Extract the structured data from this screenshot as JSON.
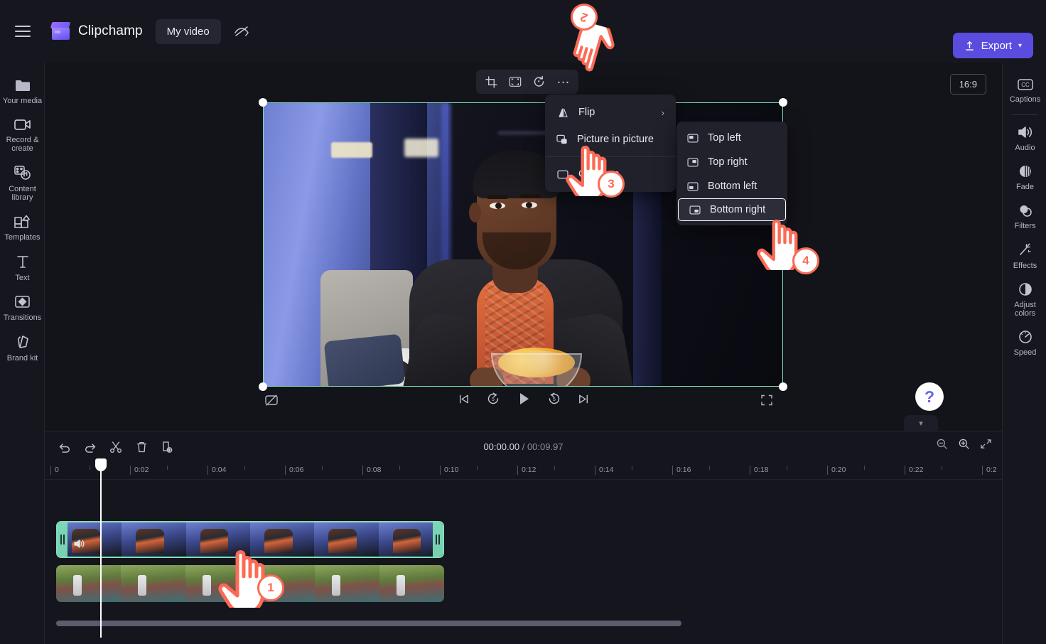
{
  "app": {
    "brand": "Clipchamp",
    "project_name": "My video",
    "export_label": "Export"
  },
  "topbar": {
    "menu_icon": "hamburger-icon",
    "logo_icon": "clipchamp-logo-icon",
    "eye_off_icon": "eye-off-icon",
    "export_icon": "upload-icon",
    "export_chevron": "chevron-down-icon"
  },
  "left_rail": {
    "items": [
      {
        "label": "Your media",
        "icon": "folder-icon"
      },
      {
        "label": "Record & create",
        "icon": "video-camera-icon"
      },
      {
        "label": "Content library",
        "icon": "content-library-icon"
      },
      {
        "label": "Templates",
        "icon": "templates-icon"
      },
      {
        "label": "Text",
        "icon": "text-icon"
      },
      {
        "label": "Transitions",
        "icon": "transitions-icon"
      },
      {
        "label": "Brand kit",
        "icon": "brand-kit-icon"
      }
    ],
    "collapse_icon": "chevron-right-icon"
  },
  "right_rail": {
    "items": [
      {
        "label": "Captions",
        "icon": "cc-icon"
      },
      {
        "label": "Audio",
        "icon": "speaker-icon"
      },
      {
        "label": "Fade",
        "icon": "fade-icon"
      },
      {
        "label": "Filters",
        "icon": "filters-icon"
      },
      {
        "label": "Effects",
        "icon": "magic-wand-icon"
      },
      {
        "label": "Adjust colors",
        "icon": "contrast-icon"
      },
      {
        "label": "Speed",
        "icon": "speedometer-icon"
      }
    ],
    "collapse_icon": "chevron-left-icon"
  },
  "stage": {
    "aspect_ratio": "16:9",
    "float_toolbar": [
      {
        "icon": "crop-icon",
        "name": "crop-button"
      },
      {
        "icon": "fit-icon",
        "name": "fit-button"
      },
      {
        "icon": "rotate-icon",
        "name": "rotate-button"
      },
      {
        "icon": "more-icon",
        "name": "more-options-button",
        "glyph": "…"
      }
    ],
    "selection_color": "#7fe0b8"
  },
  "context_menu": {
    "items": [
      {
        "label": "Flip",
        "icon": "flip-icon",
        "has_submenu": true
      },
      {
        "label": "Picture in picture",
        "icon": "picture-in-picture-icon",
        "has_submenu": true
      },
      {
        "label": "Captions",
        "icon": "captions-icon",
        "has_submenu": false
      }
    ],
    "arrow_glyph": "›"
  },
  "submenu": {
    "items": [
      {
        "label": "Top left",
        "icon": "pip-top-left-icon",
        "selected": false
      },
      {
        "label": "Top right",
        "icon": "pip-top-right-icon",
        "selected": false
      },
      {
        "label": "Bottom left",
        "icon": "pip-bottom-left-icon",
        "selected": false
      },
      {
        "label": "Bottom right",
        "icon": "pip-bottom-right-icon",
        "selected": true
      }
    ]
  },
  "player": {
    "captions_toggle_icon": "captions-off-icon",
    "controls": [
      {
        "icon": "skip-start-icon",
        "name": "skip-to-start-button"
      },
      {
        "icon": "rewind-5-icon",
        "name": "rewind-5s-button",
        "label": "5"
      },
      {
        "icon": "play-icon",
        "name": "play-button"
      },
      {
        "icon": "forward-5-icon",
        "name": "forward-5s-button",
        "label": "5"
      },
      {
        "icon": "skip-end-icon",
        "name": "skip-to-end-button"
      }
    ],
    "fullscreen_icon": "fullscreen-icon",
    "help_glyph": "?",
    "collapse_icon": "chevron-down-icon"
  },
  "timeline": {
    "tools": [
      {
        "icon": "undo-icon",
        "name": "undo-button"
      },
      {
        "icon": "redo-icon",
        "name": "redo-button"
      },
      {
        "icon": "scissors-icon",
        "name": "split-button"
      },
      {
        "icon": "trash-icon",
        "name": "delete-button"
      },
      {
        "icon": "duplicate-icon",
        "name": "duplicate-button"
      }
    ],
    "current_time": "00:00.00",
    "total_time": "00:09.97",
    "time_separator": "/",
    "zoom_out_icon": "zoom-out-icon",
    "zoom_in_icon": "zoom-in-icon",
    "fit_icon": "fit-timeline-icon",
    "ruler_labels": [
      "0",
      "0:02",
      "0:04",
      "0:06",
      "0:08",
      "0:10",
      "0:12",
      "0:14",
      "0:16",
      "0:18",
      "0:20",
      "0:22",
      "0:2"
    ],
    "tracks": [
      {
        "name": "video-clip-top",
        "selected": true,
        "has_audio_icon": true
      },
      {
        "name": "video-clip-bottom",
        "selected": false,
        "has_audio_icon": false
      }
    ]
  },
  "annotations": [
    {
      "number": "1",
      "name": "step-1-badge"
    },
    {
      "number": "2",
      "name": "step-2-badge"
    },
    {
      "number": "3",
      "name": "step-3-badge"
    },
    {
      "number": "4",
      "name": "step-4-badge"
    }
  ],
  "colors": {
    "accent": "#5b4ce0",
    "selection": "#7fe0b8",
    "annotation": "#fb6b55",
    "background": "#13131a",
    "panel": "#16161e"
  }
}
